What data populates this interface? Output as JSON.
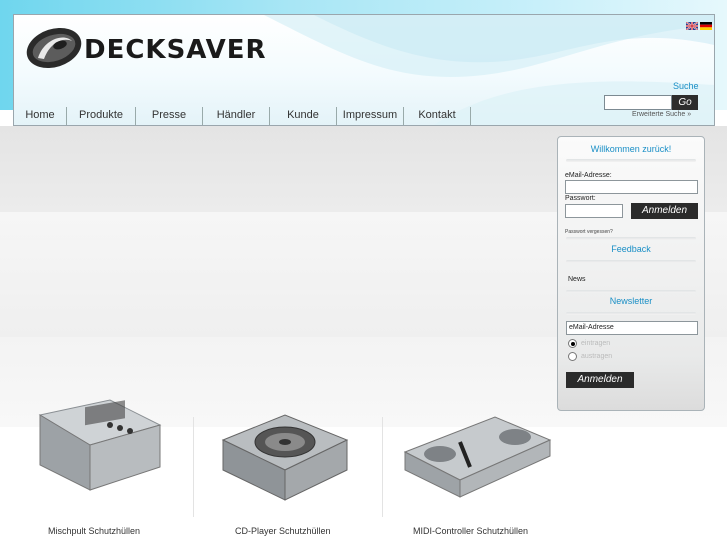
{
  "brand": {
    "name": "DECKSAVER",
    "logo_icon": "decksaver-logo-icon"
  },
  "languages": [
    {
      "name": "English",
      "icon": "uk-flag-icon"
    },
    {
      "name": "Deutsch",
      "icon": "german-flag-icon"
    }
  ],
  "search": {
    "label": "Suche",
    "placeholder": "",
    "go_label": "Go",
    "advanced_label": "Erweiterte Suche »"
  },
  "nav": {
    "items": [
      "Home",
      "Produkte",
      "Presse",
      "Händler",
      "Kunde",
      "Impressum",
      "Kontakt"
    ]
  },
  "login": {
    "title": "Willkommen zurück!",
    "email_label": "eMail-Adresse:",
    "password_label": "Passwort:",
    "submit_label": "Anmelden",
    "forgot_label": "Passwort vergessen?"
  },
  "feedback": {
    "title": "Feedback",
    "news_label": "News"
  },
  "newsletter": {
    "title": "Newsletter",
    "email_value": "eMail-Adresse",
    "subscribe_label": "eintragen",
    "unsubscribe_label": "austragen",
    "selected": "eintragen",
    "submit_label": "Anmelden"
  },
  "products": [
    {
      "label": "Mischpult Schutzhüllen"
    },
    {
      "label": "CD-Player Schutzhüllen"
    },
    {
      "label": "MIDI-Controller Schutzhüllen"
    }
  ],
  "colors": {
    "accent": "#1a8fc6",
    "dark_button": "#2b2b2b",
    "sky": "#6fd6ee"
  }
}
